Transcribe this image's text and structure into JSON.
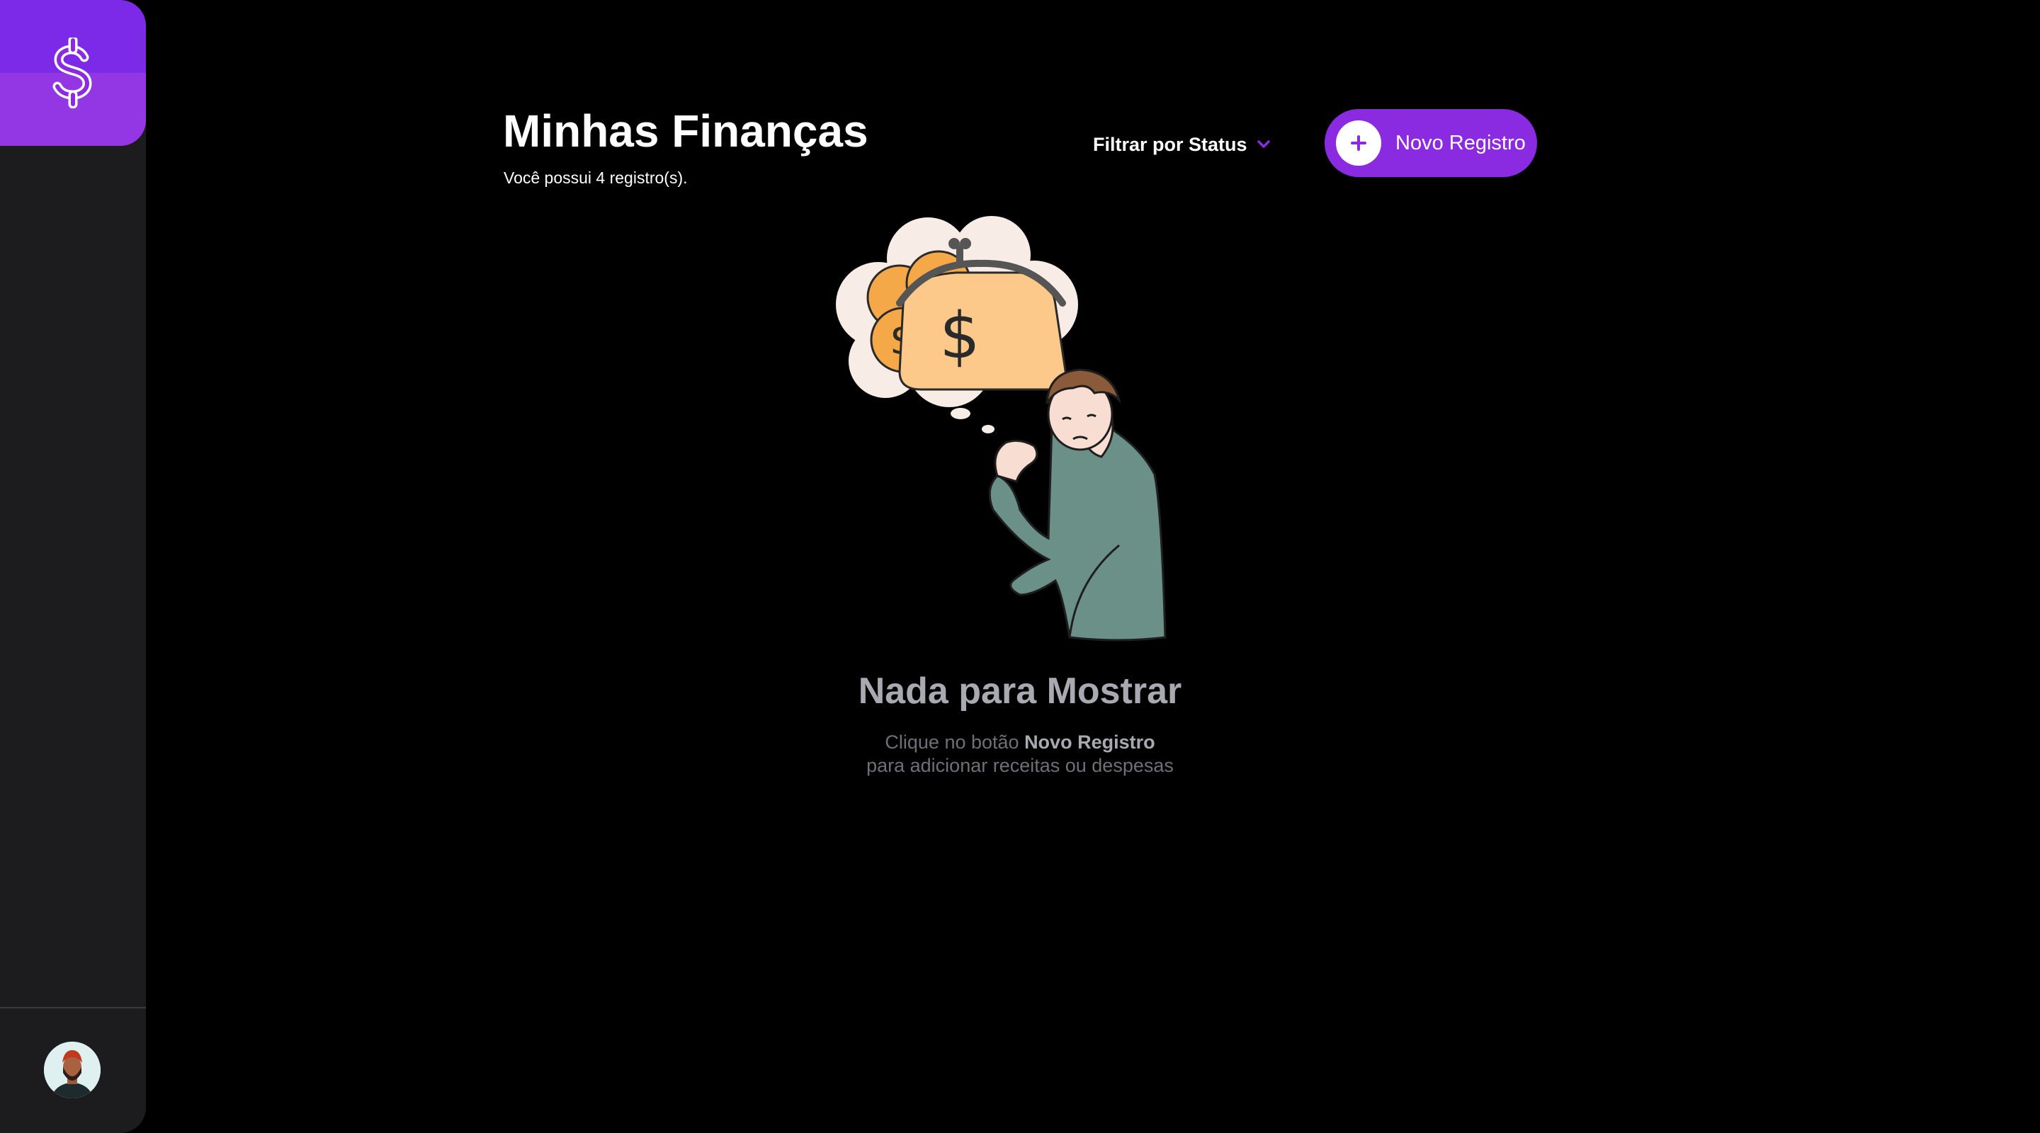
{
  "app": {
    "logo_icon": "dollar-sign-icon",
    "accent_color": "#8a2be2"
  },
  "sidebar": {
    "avatar_icon": "user-avatar"
  },
  "header": {
    "title": "Minhas Finanças",
    "subtitle": "Você possui 4 registro(s).",
    "filter_label": "Filtrar por Status",
    "filter_icon": "chevron-down-icon",
    "new_button_label": "Novo Registro",
    "new_button_icon": "plus-icon"
  },
  "empty_state": {
    "title": "Nada para Mostrar",
    "line1_prefix": "Clique no botão ",
    "line1_bold": "Novo Registro",
    "line2": "para adicionar receitas ou despesas",
    "illustration": "worried-man-thinking-about-money-illustration"
  }
}
